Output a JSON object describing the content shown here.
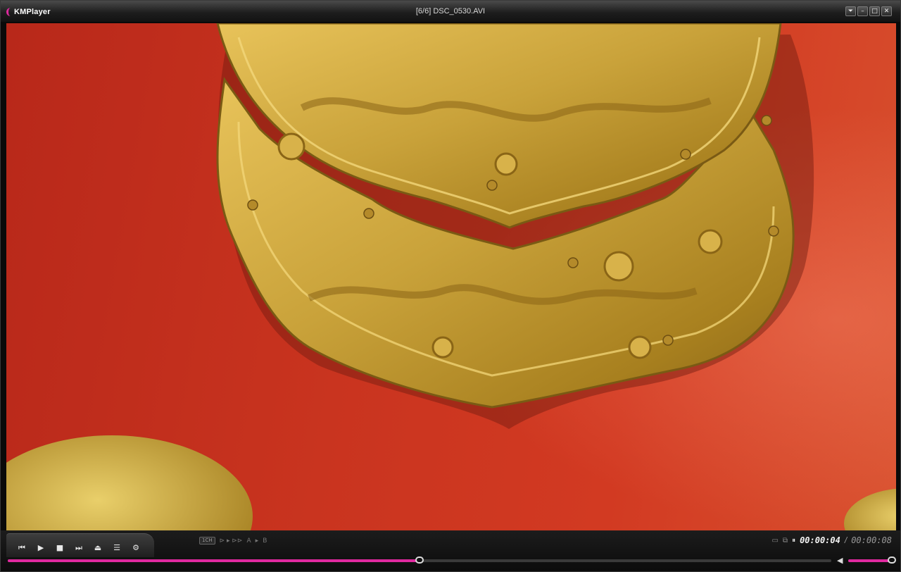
{
  "app": {
    "logo_text": "KMPlayer",
    "title": "[6/6] DSC_0530.AVI"
  },
  "window_buttons": {
    "menu": "⏷",
    "minimize": "–",
    "maximize": "□",
    "close": "✕"
  },
  "video": {
    "description_colors": {
      "background": "#c9341f",
      "ornament": "#c9a23a"
    }
  },
  "controls": {
    "prev": "⏮",
    "play": "▶",
    "stop": "■",
    "next": "⏭",
    "eject": "⏏",
    "playlist": "☰",
    "settings": "⚙"
  },
  "tools": {
    "channel_badge": "1CH",
    "frame_step": "⊳ ▸ ⊳⊳",
    "ab_a": "A",
    "ab_arrow": "▸",
    "ab_b": "B"
  },
  "status": {
    "pause_icon": "⏸",
    "current_time": "00:00:04",
    "separator": "/",
    "total_time": "00:00:08"
  },
  "seek": {
    "progress": 0.5
  },
  "volume": {
    "level": 1.0
  },
  "colors": {
    "accent": "#e0299f"
  }
}
